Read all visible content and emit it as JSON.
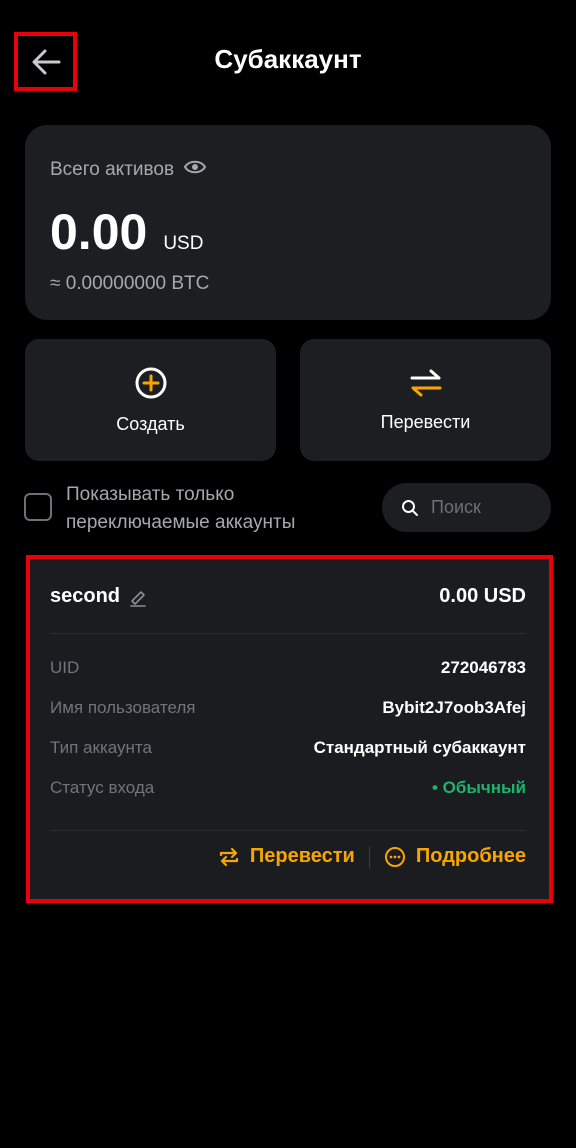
{
  "header": {
    "title": "Субаккаунт"
  },
  "assets": {
    "label": "Всего активов",
    "amount": "0.00",
    "currency": "USD",
    "btc_equiv": "≈ 0.00000000 BTC"
  },
  "actions": {
    "create_label": "Создать",
    "transfer_label": "Перевести"
  },
  "filter": {
    "checkbox_label": "Показывать только переключаемые аккаунты",
    "search_placeholder": "Поиск"
  },
  "subaccount": {
    "name": "second",
    "balance": "0.00 USD",
    "rows": [
      {
        "key": "UID",
        "value": "272046783"
      },
      {
        "key": "Имя пользователя",
        "value": "Bybit2J7oob3Afej"
      },
      {
        "key": "Тип аккаунта",
        "value": "Стандартный субаккаунт"
      },
      {
        "key": "Статус входа",
        "value": "• Обычный"
      }
    ],
    "transfer_label": "Перевести",
    "details_label": "Подробнее"
  },
  "colors": {
    "background": "#000000",
    "card": "#1d1e22",
    "accent": "#f7a600",
    "status_green": "#20b26c",
    "highlight_red": "#e8000b"
  },
  "icons": [
    "back-arrow-icon",
    "eye-icon",
    "plus-circle-icon",
    "swap-arrows-icon",
    "search-icon",
    "edit-pencil-icon",
    "transfer-icon",
    "more-dots-icon"
  ]
}
